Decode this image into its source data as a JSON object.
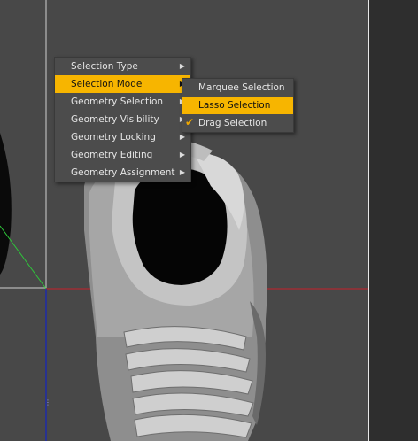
{
  "context_menu": {
    "items": [
      {
        "label": "Selection Type",
        "has_submenu": true,
        "highlighted": false
      },
      {
        "label": "Selection Mode",
        "has_submenu": true,
        "highlighted": true
      },
      {
        "label": "Geometry Selection",
        "has_submenu": true,
        "highlighted": false
      },
      {
        "label": "Geometry Visibility",
        "has_submenu": true,
        "highlighted": false
      },
      {
        "label": "Geometry Locking",
        "has_submenu": true,
        "highlighted": false
      },
      {
        "label": "Geometry Editing",
        "has_submenu": true,
        "highlighted": false
      },
      {
        "label": "Geometry Assignment",
        "has_submenu": true,
        "highlighted": false
      }
    ],
    "arrow_glyph": "▶"
  },
  "submenu": {
    "items": [
      {
        "label": "Marquee Selection",
        "highlighted": false,
        "checked": false
      },
      {
        "label": "Lasso Selection",
        "highlighted": true,
        "checked": false
      },
      {
        "label": "Drag Selection",
        "highlighted": false,
        "checked": true
      }
    ],
    "check_glyph": "✔"
  },
  "colors": {
    "highlight": "#f7b500",
    "x_axis": "#c8202a",
    "y_axis": "#1e2aa8",
    "z_axis": "#2ec83a",
    "model": "#9c9c9c"
  }
}
